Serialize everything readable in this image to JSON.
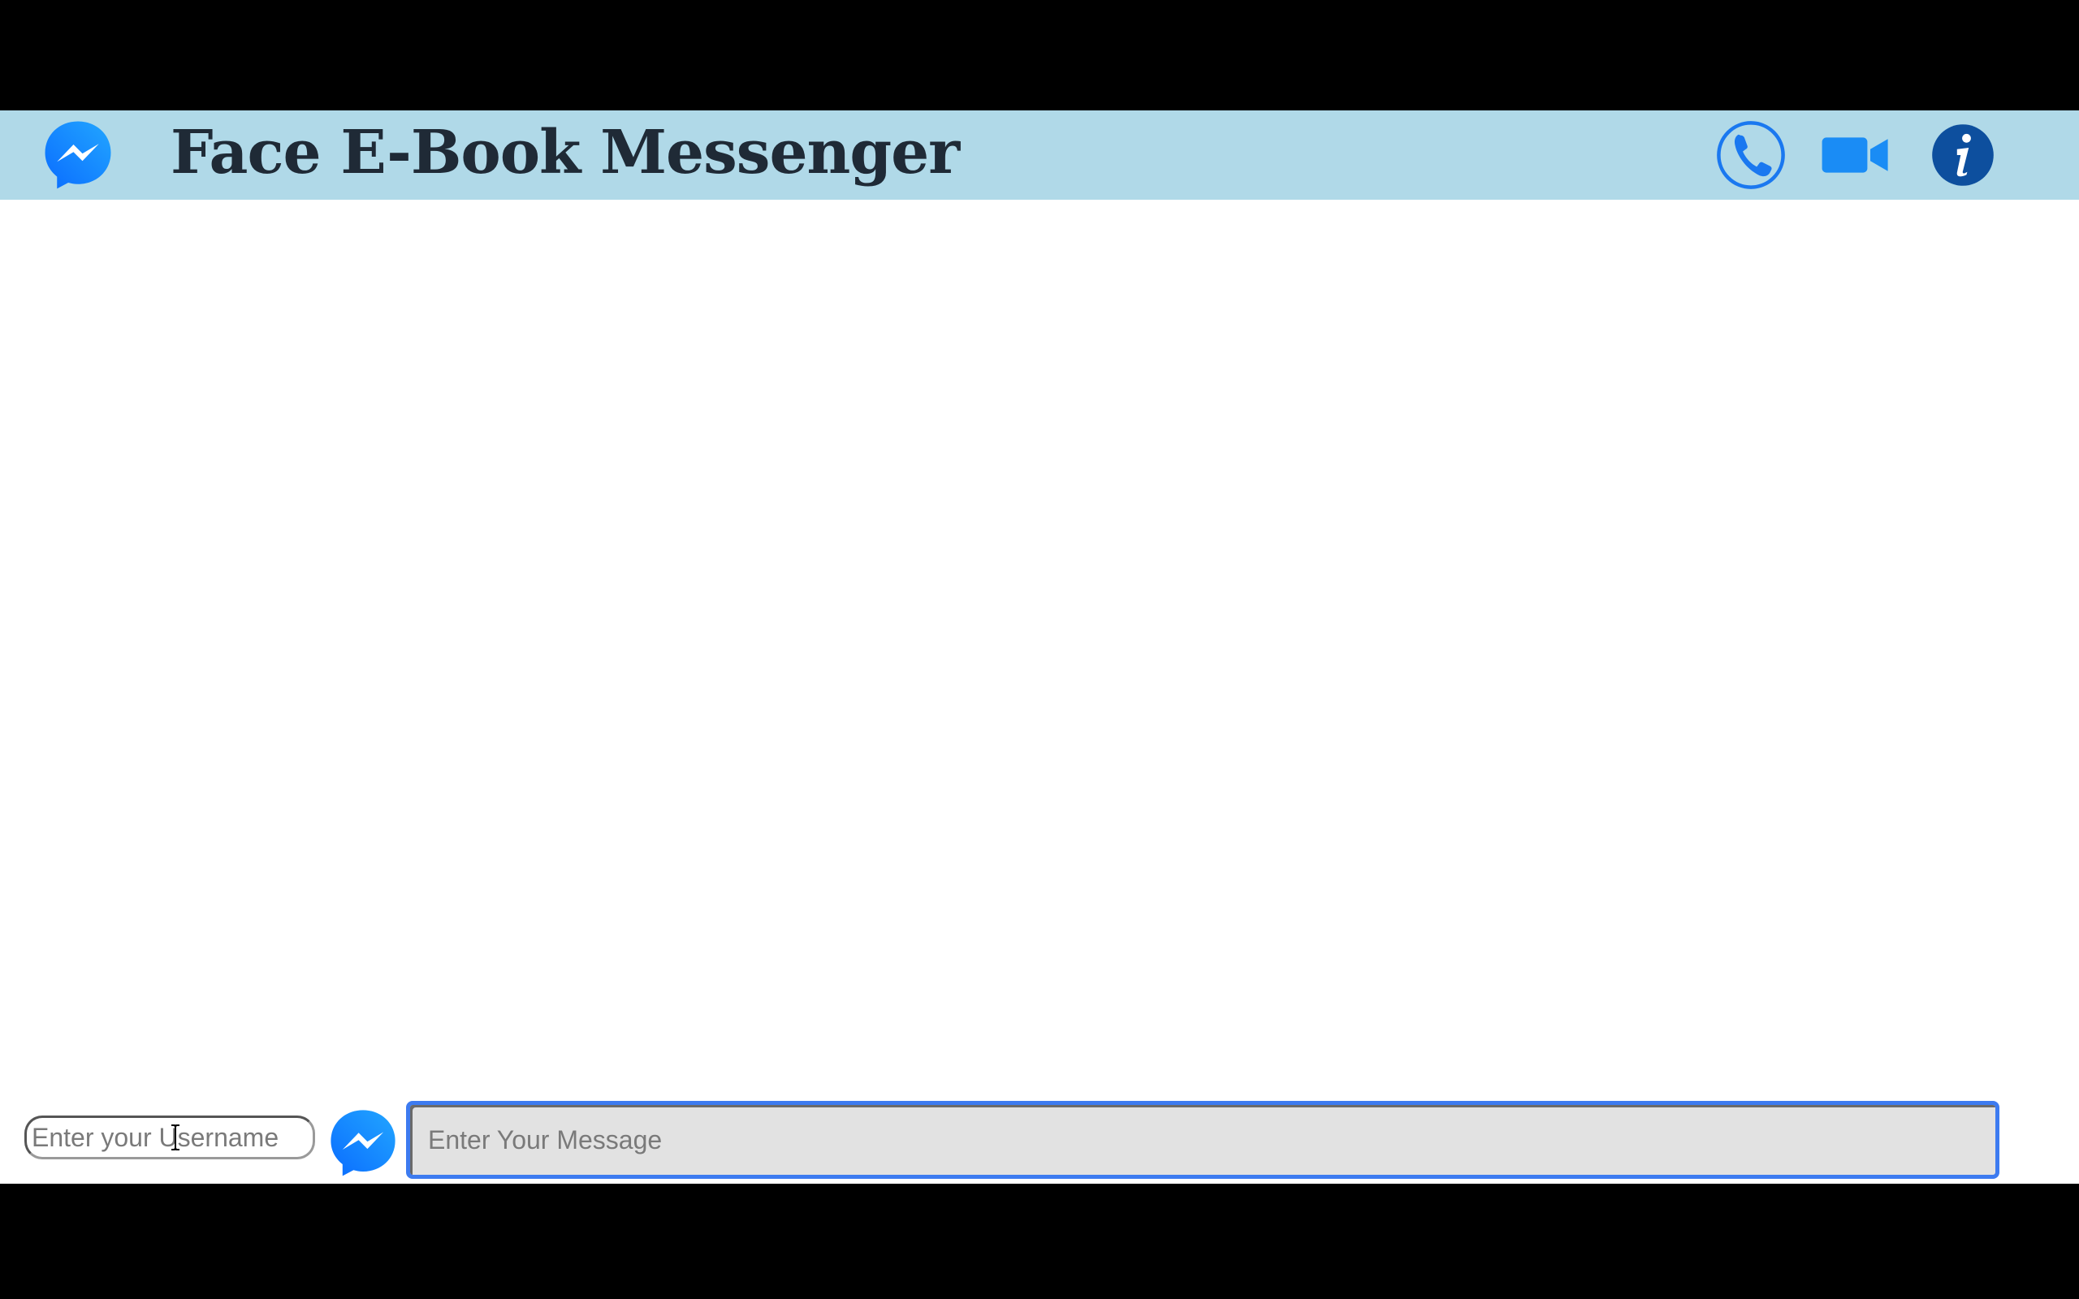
{
  "header": {
    "title": "Face E-Book Messenger",
    "logo_icon": "messenger-logo-icon",
    "buttons": [
      {
        "name": "phone-call-button",
        "icon": "phone-icon"
      },
      {
        "name": "video-call-button",
        "icon": "video-camera-icon"
      },
      {
        "name": "info-button",
        "icon": "info-icon"
      }
    ]
  },
  "footer": {
    "username_placeholder": "Enter your Username",
    "username_value": "",
    "send_icon": "messenger-send-icon",
    "message_placeholder": "Enter Your Message",
    "message_value": ""
  },
  "colors": {
    "header_bg": "#b0d9e8",
    "title_color": "#1f2a36",
    "messenger_blue": "#1a8cff",
    "info_blue": "#0d4f9e",
    "focus_ring": "#3d7bf0"
  }
}
